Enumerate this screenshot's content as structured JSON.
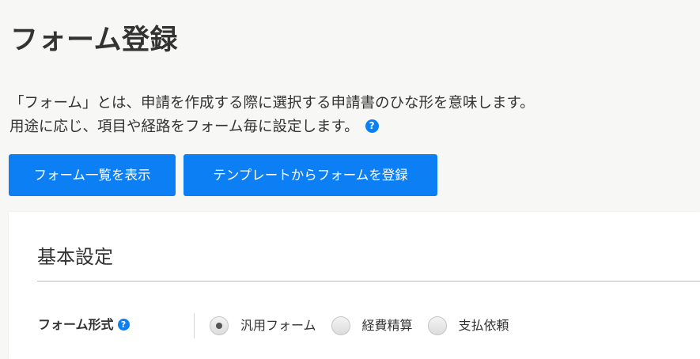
{
  "page": {
    "title": "フォーム登録",
    "description_line1": "「フォーム」とは、申請を作成する際に選択する申請書のひな形を意味します。",
    "description_line2": "用途に応じ、項目や経路をフォーム毎に設定します。",
    "help_icon_glyph": "?"
  },
  "actions": {
    "list_button_label": "フォーム一覧を表示",
    "template_button_label": "テンプレートからフォームを登録"
  },
  "basic_settings": {
    "section_title": "基本設定",
    "form_type": {
      "label": "フォーム形式",
      "help_icon_glyph": "?",
      "options": [
        {
          "label": "汎用フォーム",
          "selected": true
        },
        {
          "label": "経費精算",
          "selected": false
        },
        {
          "label": "支払依頼",
          "selected": false
        }
      ]
    }
  },
  "colors": {
    "accent": "#0d7ff5",
    "background": "#f7f7f5",
    "text": "#333333"
  }
}
